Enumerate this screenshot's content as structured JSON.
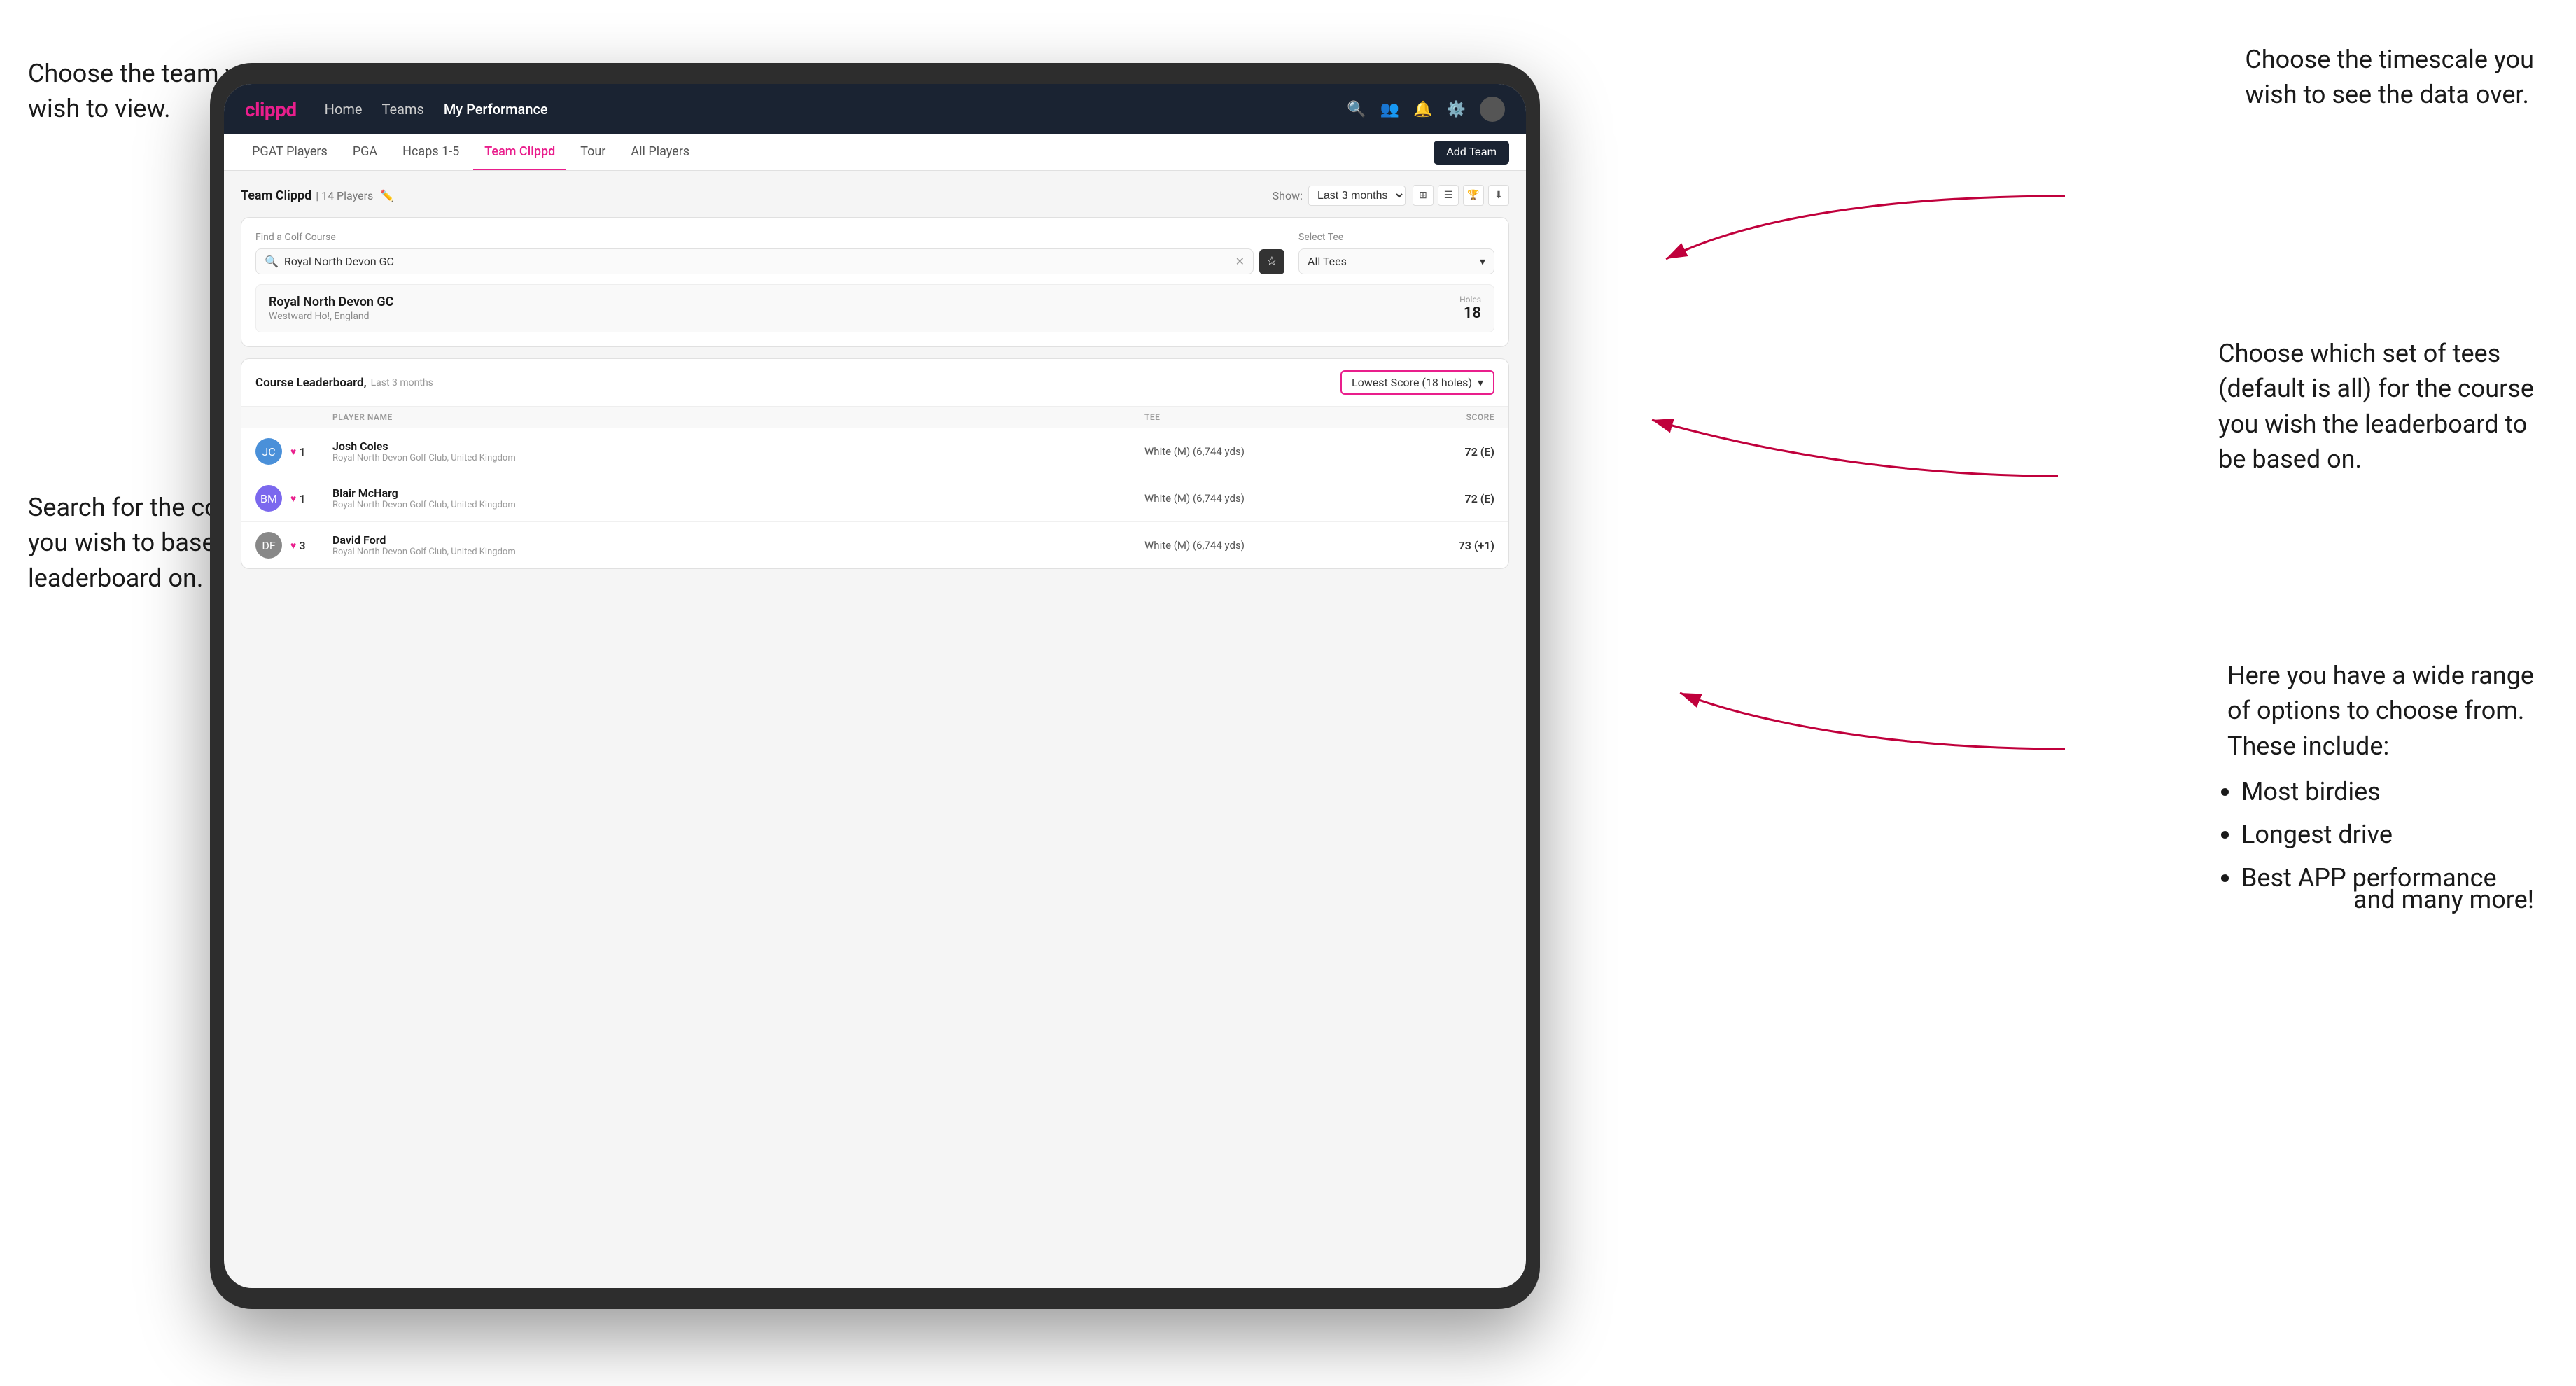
{
  "annotations": {
    "top_left": "Choose the team you\nwish to view.",
    "top_right": "Choose the timescale you\nwish to see the data over.",
    "mid_right": "Choose which set of tees\n(default is all) for the course\nyou wish the leaderboard to\nbe based on.",
    "mid_left": "Search for the course\nyou wish to base the\nleaderboard on.",
    "bottom_right_intro": "Here you have a wide range\nof options to choose from.\nThese include:",
    "bullet1": "Most birdies",
    "bullet2": "Longest drive",
    "bullet3": "Best APP performance",
    "and_more": "and many more!"
  },
  "nav": {
    "logo": "clippd",
    "links": [
      "Home",
      "Teams",
      "My Performance"
    ],
    "active_link": "My Performance"
  },
  "sub_nav": {
    "tabs": [
      "PGAT Players",
      "PGA",
      "Hcaps 1-5",
      "Team Clippd",
      "Tour",
      "All Players"
    ],
    "active_tab": "Team Clippd",
    "add_team_label": "Add Team"
  },
  "team_header": {
    "title": "Team Clippd",
    "count": "14 Players",
    "show_label": "Show:",
    "show_value": "Last 3 months"
  },
  "search": {
    "label_course": "Find a Golf Course",
    "placeholder": "Royal North Devon GC",
    "label_tee": "Select Tee",
    "tee_value": "All Tees"
  },
  "course_result": {
    "name": "Royal North Devon GC",
    "location": "Westward Ho!, England",
    "holes_label": "Holes",
    "holes_value": "18"
  },
  "leaderboard": {
    "title": "Course Leaderboard,",
    "subtitle": "Last 3 months",
    "score_type": "Lowest Score (18 holes)",
    "columns": {
      "player": "PLAYER NAME",
      "tee": "TEE",
      "score": "SCORE"
    },
    "players": [
      {
        "rank": "1",
        "name": "Josh Coles",
        "club": "Royal North Devon Golf Club, United Kingdom",
        "tee": "White (M) (6,744 yds)",
        "score": "72 (E)",
        "initials": "JC"
      },
      {
        "rank": "1",
        "name": "Blair McHarg",
        "club": "Royal North Devon Golf Club, United Kingdom",
        "tee": "White (M) (6,744 yds)",
        "score": "72 (E)",
        "initials": "BM"
      },
      {
        "rank": "3",
        "name": "David Ford",
        "club": "Royal North Devon Golf Club, United Kingdom",
        "tee": "White (M) (6,744 yds)",
        "score": "73 (+1)",
        "initials": "DF"
      }
    ]
  },
  "colors": {
    "brand_pink": "#e91e8c",
    "nav_bg": "#1a2332",
    "accent": "#e91e8c"
  }
}
